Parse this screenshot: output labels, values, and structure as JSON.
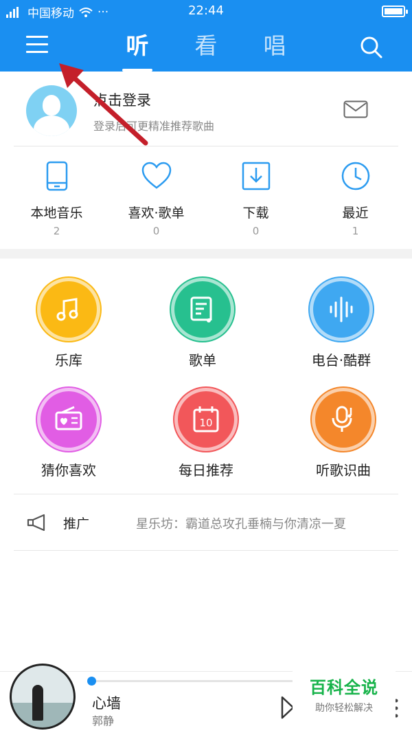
{
  "status_bar": {
    "carrier": "中国移动",
    "dots": "···",
    "time": "22:44"
  },
  "header": {
    "tabs": [
      {
        "label": "听",
        "active": true
      },
      {
        "label": "看",
        "active": false
      },
      {
        "label": "唱",
        "active": false
      }
    ]
  },
  "login": {
    "title": "点击登录",
    "subtitle": "登录后可更精准推荐歌曲"
  },
  "quick": [
    {
      "label": "本地音乐",
      "count": "2",
      "icon": "phone-icon"
    },
    {
      "label": "喜欢·歌单",
      "count": "0",
      "icon": "heart-icon"
    },
    {
      "label": "下载",
      "count": "0",
      "icon": "download-icon"
    },
    {
      "label": "最近",
      "count": "1",
      "icon": "clock-icon"
    }
  ],
  "grid": [
    {
      "label": "乐库",
      "color": "#fbb914",
      "icon": "music-note-icon"
    },
    {
      "label": "歌单",
      "color": "#27c08f",
      "icon": "playlist-icon"
    },
    {
      "label": "电台·酷群",
      "color": "#3fa8f1",
      "icon": "soundwave-icon"
    },
    {
      "label": "猜你喜欢",
      "color": "#e15de4",
      "icon": "radio-icon"
    },
    {
      "label": "每日推荐",
      "color": "#f2575a",
      "icon": "calendar-icon"
    },
    {
      "label": "听歌识曲",
      "color": "#f4872b",
      "icon": "mic-note-icon"
    }
  ],
  "calendar_day": "10",
  "promo": {
    "tag": "推广",
    "text": "星乐坊：霸道总攻孔垂楠与你清凉一夏"
  },
  "player": {
    "song": "心墙",
    "artist": "郭静",
    "progress": 0.0
  },
  "watermark": {
    "title": "百科全说",
    "subtitle": "助你轻松解决"
  },
  "colors": {
    "brand": "#1a8ff1",
    "icon_stroke": "#2b9bf0"
  }
}
